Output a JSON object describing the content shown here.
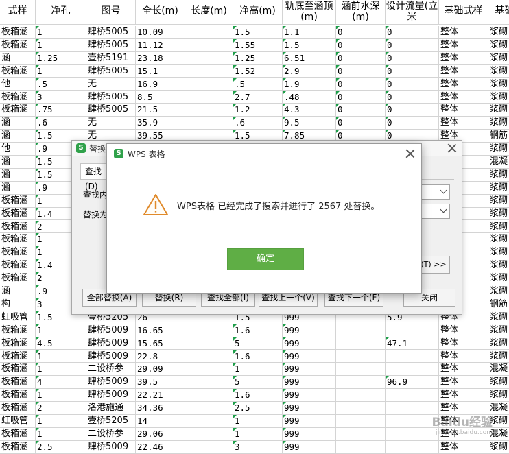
{
  "sheet": {
    "headers": [
      "式样",
      "净孔",
      "图号",
      "全长(m)",
      "长度(m)",
      "净高(m)",
      "轨底至涵顶(m)",
      "涵前水深(m)",
      "设计流量(立米",
      "基础式样",
      "基础"
    ],
    "rows": [
      [
        "板箱涵",
        "1",
        "肆桥5005",
        "10.09",
        "",
        "1.5",
        "1.1",
        "0",
        "0",
        "整体",
        "浆砌"
      ],
      [
        "板箱涵",
        "1",
        "肆桥5005",
        "11.12",
        "",
        "1.55",
        "1.5",
        "0",
        "0",
        "整体",
        "浆砌"
      ],
      [
        "涵",
        "1.25",
        "壹桥5191",
        "23.18",
        "",
        "1.25",
        "6.51",
        "0",
        "0",
        "整体",
        "浆砌"
      ],
      [
        "板箱涵",
        "1",
        "肆桥5005",
        "15.1",
        "",
        "1.52",
        "2.9",
        "0",
        "0",
        "整体",
        "浆砌"
      ],
      [
        "他",
        ".5",
        "无",
        "16.9",
        "",
        ".5",
        "1.9",
        "0",
        "0",
        "整体",
        "浆砌"
      ],
      [
        "板箱涵",
        "3",
        "肆桥5005",
        "8.5",
        "",
        "2.7",
        ".48",
        "0",
        "0",
        "整体",
        "浆砌"
      ],
      [
        "板箱涵",
        ".75",
        "肆桥5005",
        "21.5",
        "",
        "1.2",
        "4.3",
        "0",
        "0",
        "整体",
        "浆砌"
      ],
      [
        "涵",
        ".6",
        "无",
        "35.9",
        "",
        ".6",
        "9.5",
        "0",
        "0",
        "整体",
        "浆砌"
      ],
      [
        "涵",
        "1.5",
        "无",
        "39.55",
        "",
        "1.5",
        "7.85",
        "0",
        "0",
        "整体",
        "钢筋"
      ],
      [
        "他",
        ".9",
        "",
        "",
        "",
        "",
        "",
        "",
        "",
        "",
        "浆砌"
      ],
      [
        "涵",
        "1.5",
        "",
        "",
        "",
        "",
        "",
        "",
        "",
        "",
        "混凝"
      ],
      [
        "涵",
        "1.5",
        "",
        "",
        "",
        "",
        "",
        "",
        "",
        "",
        "浆砌"
      ],
      [
        "涵",
        ".9",
        "",
        "",
        "",
        "",
        "",
        "",
        "",
        "",
        "浆砌"
      ],
      [
        "板箱涵",
        "1",
        "",
        "",
        "",
        "",
        "",
        "",
        "",
        "",
        "浆砌"
      ],
      [
        "板箱涵",
        "1.4",
        "",
        "",
        "",
        "",
        "",
        "",
        "",
        "",
        "浆砌"
      ],
      [
        "板箱涵",
        "2",
        "",
        "",
        "",
        "",
        "",
        "",
        "",
        "",
        "浆砌"
      ],
      [
        "板箱涵",
        "1",
        "",
        "",
        "",
        "",
        "",
        "",
        "",
        "",
        "浆砌"
      ],
      [
        "板箱涵",
        "1",
        "",
        "",
        "",
        "",
        "",
        "",
        "",
        "",
        "浆砌"
      ],
      [
        "板箱涵",
        "1.4",
        "",
        "",
        "",
        "",
        "",
        "",
        "",
        "",
        "浆砌"
      ],
      [
        "板箱涵",
        "2",
        "",
        "",
        "",
        "",
        "",
        "",
        "",
        "",
        "浆砌"
      ],
      [
        "涵",
        ".9",
        "",
        "",
        "",
        "",
        "",
        "",
        "",
        "",
        "浆砌"
      ],
      [
        "构",
        "3",
        "",
        "",
        "",
        "",
        "",
        "",
        "",
        "",
        "钢筋"
      ],
      [
        "虹吸管",
        "1.5",
        "壹桥5205",
        "26",
        "",
        "1.5",
        "999",
        "",
        "5.9",
        "整体",
        "浆砌"
      ],
      [
        "板箱涵",
        "1",
        "肆桥5009",
        "16.65",
        "",
        "1.6",
        "999",
        "",
        "",
        "整体",
        "浆砌"
      ],
      [
        "板箱涵",
        "4.5",
        "肆桥5009",
        "15.65",
        "",
        "5",
        "999",
        "",
        "47.1",
        "整体",
        "浆砌"
      ],
      [
        "板箱涵",
        "1",
        "肆桥5009",
        "22.8",
        "",
        "1.6",
        "999",
        "",
        "",
        "整体",
        "浆砌"
      ],
      [
        "板箱涵",
        "1",
        "二设桥参",
        "29.09",
        "",
        "1",
        "999",
        "",
        "",
        "整体",
        "混凝"
      ],
      [
        "板箱涵",
        "4",
        "肆桥5009",
        "39.5",
        "",
        "5",
        "999",
        "",
        "96.9",
        "整体",
        "浆砌"
      ],
      [
        "板箱涵",
        "1",
        "肆桥5009",
        "22.21",
        "",
        "1.6",
        "999",
        "",
        "",
        "整体",
        "浆砌"
      ],
      [
        "板箱涵",
        "2",
        "洛港施通",
        "34.36",
        "",
        "2.5",
        "999",
        "",
        "",
        "整体",
        "混凝"
      ],
      [
        "虹吸管",
        "1",
        "壹桥5205",
        "14",
        "",
        "1",
        "999",
        "",
        "",
        "整体",
        "浆砌"
      ],
      [
        "板箱涵",
        "1",
        "二设桥参",
        "29.06",
        "",
        "1",
        "999",
        "",
        "",
        "整体",
        "混凝"
      ],
      [
        "板箱涵",
        "2.5",
        "肆桥5009",
        "22.46",
        "",
        "3",
        "999",
        "",
        "",
        "整体",
        "浆砌"
      ]
    ]
  },
  "replace_dialog": {
    "title": "替换",
    "tab": "查找(D)",
    "find_label": "查找内",
    "replace_label": "替换为",
    "options_button": "(T) >>",
    "buttons": [
      "全部替换(A)",
      "替换(R)",
      "查找全部(I)",
      "查找上一个(V)",
      "查找下一个(F)",
      "关闭"
    ]
  },
  "message_dialog": {
    "logo": "S",
    "title": "WPS 表格",
    "message": "WPS表格 已经完成了搜索并进行了 2567 处替换。",
    "ok_label": "确定",
    "warning_color": "#e08a2b",
    "ok_color": "#5fae45"
  },
  "watermark": {
    "brand": "Baidu经验",
    "url": "jingyan.baidu.com"
  }
}
